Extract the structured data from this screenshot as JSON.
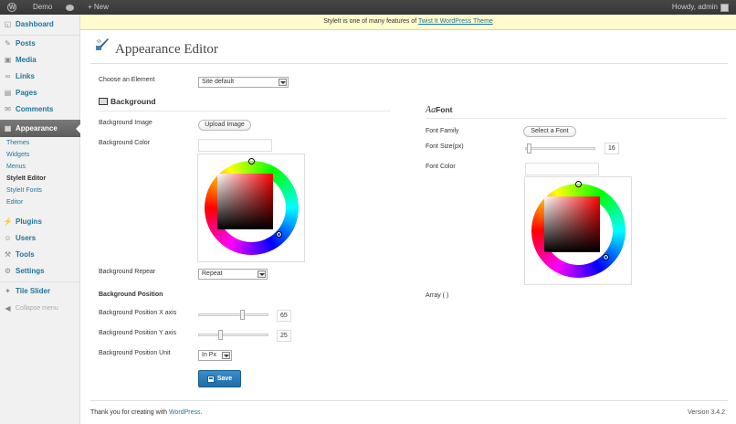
{
  "adminbar": {
    "site_name": "Demo",
    "new_label": "+ New",
    "howdy": "Howdy, admin"
  },
  "sidebar": {
    "dashboard": "Dashboard",
    "posts": "Posts",
    "media": "Media",
    "links": "Links",
    "pages": "Pages",
    "comments": "Comments",
    "appearance": "Appearance",
    "appearance_sub": [
      "Themes",
      "Widgets",
      "Menus",
      "StyleIt Editor",
      "StyleIt Fonts",
      "Editor"
    ],
    "plugins": "Plugins",
    "users": "Users",
    "tools": "Tools",
    "settings": "Settings",
    "tile_slider": "Tile Slider",
    "collapse": "Collapse menu"
  },
  "notice": {
    "text": "StyleIt is one of many features of ",
    "link": "Twist It WordPress Theme"
  },
  "page": {
    "title": "Appearance Editor"
  },
  "element": {
    "label": "Choose an Element",
    "value": "Site default"
  },
  "background": {
    "heading": "Background",
    "image_label": "Background Image",
    "upload_button": "Upload Image",
    "color_label": "Background Color",
    "repeat_label": "Background Repear",
    "repeat_value": "Repeat",
    "position_heading": "Background Position",
    "pos_x_label": "Background Position X axis",
    "pos_x_value": "65",
    "pos_y_label": "Background Position Y axis",
    "pos_y_value": "25",
    "unit_label": "Background Position Unit",
    "unit_value": "In Px",
    "save_button": "Save"
  },
  "font": {
    "heading_prefix": "Aa",
    "heading": "Font",
    "family_label": "Font Family",
    "family_button": "Select a Font",
    "size_label": "Font Size(px)",
    "size_value": "16",
    "color_label": "Font Color",
    "array_text": "Array ( )"
  },
  "footer": {
    "thanks": "Thank you for creating with ",
    "link": "WordPress",
    "dot": ".",
    "version": "Version 3.4.2"
  },
  "colors": {
    "accent": "#21759b",
    "notice_bg": "#fffbcc",
    "adminbar": "#464646"
  }
}
